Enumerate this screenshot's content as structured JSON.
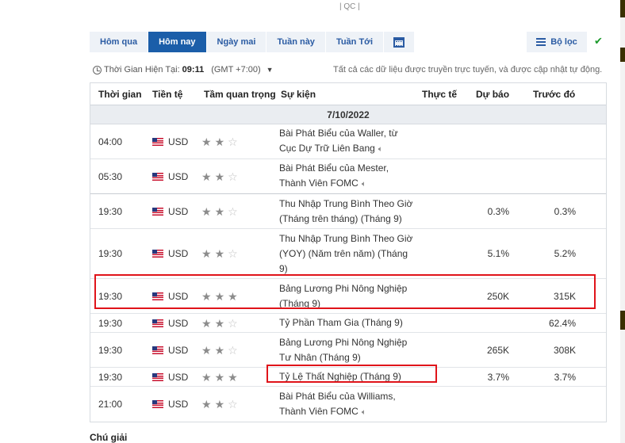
{
  "ad_label": "| QC |",
  "tabs": [
    {
      "label": "Hôm qua",
      "active": false
    },
    {
      "label": "Hôm nay",
      "active": true
    },
    {
      "label": "Ngày mai",
      "active": false
    },
    {
      "label": "Tuần này",
      "active": false
    },
    {
      "label": "Tuần Tới",
      "active": false
    }
  ],
  "calendar_icon": "calendar-icon",
  "filter": {
    "label": "Bộ lọc",
    "icon": "sliders-icon",
    "confirm_icon": "check-icon"
  },
  "timebar": {
    "prefix": "Thời Gian Hiện Tại:",
    "time": "09:11",
    "zone": "(GMT +7:00)"
  },
  "live_note": "Tất cả các dữ liệu được truyền trực tuyến, và được cập nhật tự động.",
  "columns": {
    "time": "Thời gian",
    "currency": "Tiền tệ",
    "importance": "Tầm quan trọng",
    "event": "Sự kiện",
    "actual": "Thực tế",
    "forecast": "Dự báo",
    "previous": "Trước đó"
  },
  "date": "7/10/2022",
  "rows": [
    {
      "time": "04:00",
      "currency": "USD",
      "stars": 2,
      "event_line1": "Bài Phát Biểu của Waller, từ",
      "event_line2": "Cục Dự Trữ Liên Bang",
      "speech": true,
      "actual": "",
      "forecast": "",
      "previous": ""
    },
    {
      "time": "05:30",
      "currency": "USD",
      "stars": 2,
      "event_line1": "Bài Phát Biểu của Mester,",
      "event_line2": "Thành Viên FOMC",
      "speech": true,
      "actual": "",
      "forecast": "",
      "previous": ""
    },
    {
      "time": "19:30",
      "currency": "USD",
      "stars": 2,
      "event_line1": "Thu Nhập Trung Bình Theo Giờ",
      "event_line2": "(Tháng trên tháng) (Tháng 9)",
      "speech": false,
      "actual": "",
      "forecast": "0.3%",
      "previous": "0.3%"
    },
    {
      "time": "19:30",
      "currency": "USD",
      "stars": 2,
      "event_line1": "Thu Nhập Trung Bình Theo Giờ",
      "event_line2": "(YOY) (Năm trên năm) (Tháng",
      "event_line3": "9)",
      "speech": false,
      "actual": "",
      "forecast": "5.1%",
      "previous": "5.2%"
    },
    {
      "time": "19:30",
      "currency": "USD",
      "stars": 3,
      "event_line1": "Bảng Lương Phi Nông Nghiệp",
      "event_line2": "(Tháng 9)",
      "speech": false,
      "actual": "",
      "forecast": "250K",
      "previous": "315K"
    },
    {
      "time": "19:30",
      "currency": "USD",
      "stars": 2,
      "event_line1": "Tỷ Phần Tham Gia (Tháng 9)",
      "speech": false,
      "actual": "",
      "forecast": "",
      "previous": "62.4%"
    },
    {
      "time": "19:30",
      "currency": "USD",
      "stars": 2,
      "event_line1": "Bảng Lương Phi Nông Nghiệp",
      "event_line2": "Tư Nhân (Tháng 9)",
      "speech": false,
      "actual": "",
      "forecast": "265K",
      "previous": "308K"
    },
    {
      "time": "19:30",
      "currency": "USD",
      "stars": 3,
      "event_line1": "Tỷ Lệ Thất Nghiệp (Tháng 9)",
      "speech": false,
      "actual": "",
      "forecast": "3.7%",
      "previous": "3.7%"
    },
    {
      "time": "21:00",
      "currency": "USD",
      "stars": 2,
      "event_line1": "Bài Phát Biểu của Williams,",
      "event_line2": "Thành Viên FOMC",
      "speech": true,
      "actual": "",
      "forecast": "",
      "previous": ""
    }
  ],
  "legend_title": "Chú giải"
}
